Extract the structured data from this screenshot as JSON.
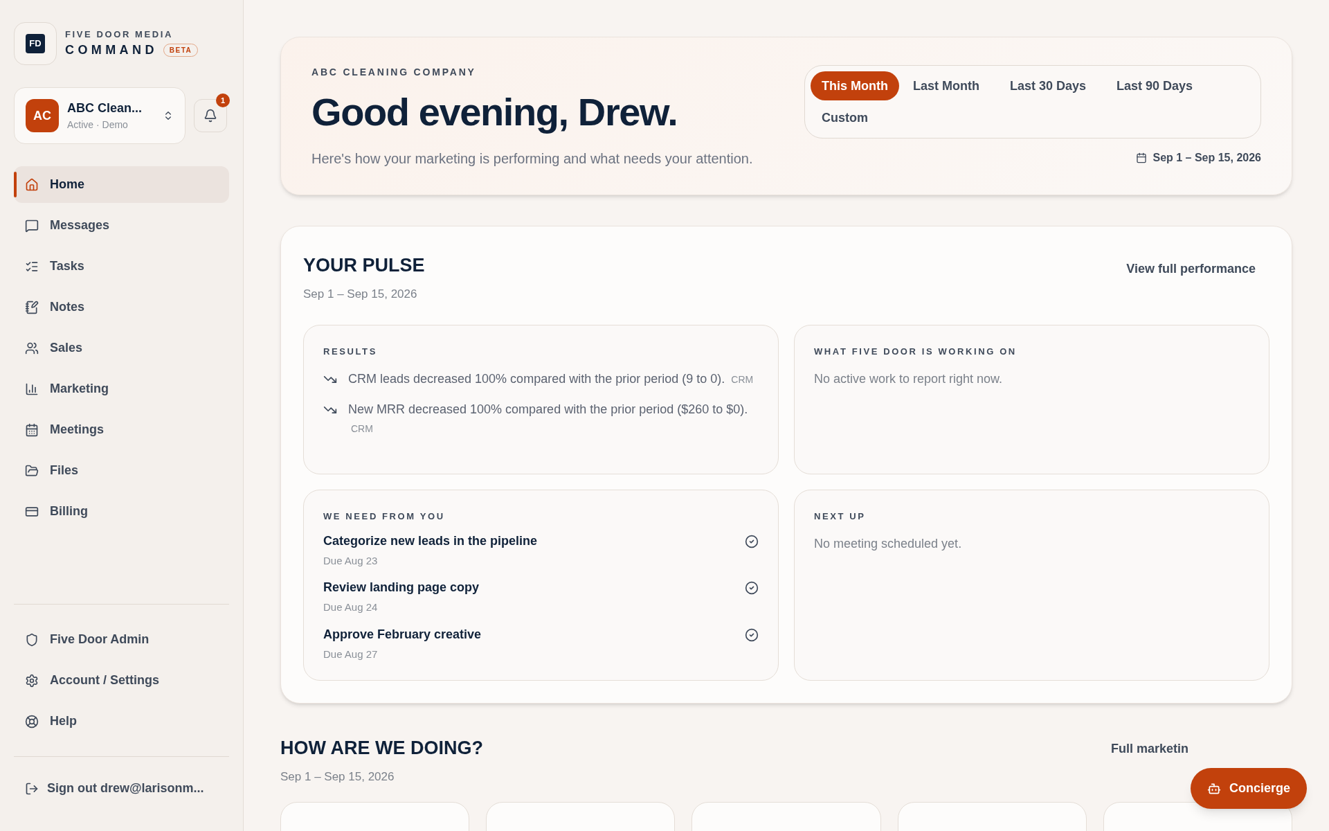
{
  "brand": {
    "logo": "FD",
    "overline": "FIVE DOOR MEDIA",
    "name": "COMMAND",
    "badge": "BETA"
  },
  "account": {
    "initials": "AC",
    "name": "ABC Clean...",
    "status": "Active · Demo"
  },
  "notifications": {
    "count": "1"
  },
  "nav": [
    {
      "label": "Home",
      "selected": true
    },
    {
      "label": "Messages",
      "selected": false
    },
    {
      "label": "Tasks",
      "selected": false
    },
    {
      "label": "Notes",
      "selected": false
    },
    {
      "label": "Sales",
      "selected": false
    },
    {
      "label": "Marketing",
      "selected": false
    },
    {
      "label": "Meetings",
      "selected": false
    },
    {
      "label": "Files",
      "selected": false
    },
    {
      "label": "Billing",
      "selected": false
    }
  ],
  "footer_nav": [
    {
      "label": "Five Door Admin"
    },
    {
      "label": "Account / Settings"
    },
    {
      "label": "Help"
    }
  ],
  "sign_out": "Sign out drew@larisonm...",
  "header": {
    "company": "ABC CLEANING COMPANY",
    "greeting": "Good evening, Drew.",
    "subtitle": "Here's how your marketing is performing and what needs your attention.",
    "ranges": [
      {
        "label": "This Month",
        "selected": true
      },
      {
        "label": "Last Month",
        "selected": false
      },
      {
        "label": "Last 30 Days",
        "selected": false
      },
      {
        "label": "Last 90 Days",
        "selected": false
      },
      {
        "label": "Custom",
        "selected": false
      }
    ],
    "date_range": "Sep 1 – Sep 15, 2026"
  },
  "pulse": {
    "title": "YOUR PULSE",
    "dates": "Sep 1 – Sep 15, 2026",
    "link": "View full performance",
    "results": {
      "title": "RESULTS",
      "items": [
        {
          "text": "CRM leads decreased 100% compared with the prior period (9 to 0).",
          "source": "CRM"
        },
        {
          "text": "New MRR decreased 100% compared with the prior period ($260 to $0).",
          "source": "CRM"
        }
      ]
    },
    "working_on": {
      "title": "WHAT FIVE DOOR IS WORKING ON",
      "empty": "No active work to report right now."
    },
    "need_from_you": {
      "title": "WE NEED FROM YOU",
      "tasks": [
        {
          "title": "Categorize new leads in the pipeline",
          "due": "Due Aug 23"
        },
        {
          "title": "Review landing page copy",
          "due": "Due Aug 24"
        },
        {
          "title": "Approve February creative",
          "due": "Due Aug 27"
        }
      ]
    },
    "next_up": {
      "title": "NEXT UP",
      "empty": "No meeting scheduled yet."
    }
  },
  "doing": {
    "title": "HOW ARE WE DOING?",
    "dates": "Sep 1 – Sep 15, 2026",
    "link": "Full marketin"
  },
  "concierge": {
    "label": "Concierge"
  }
}
